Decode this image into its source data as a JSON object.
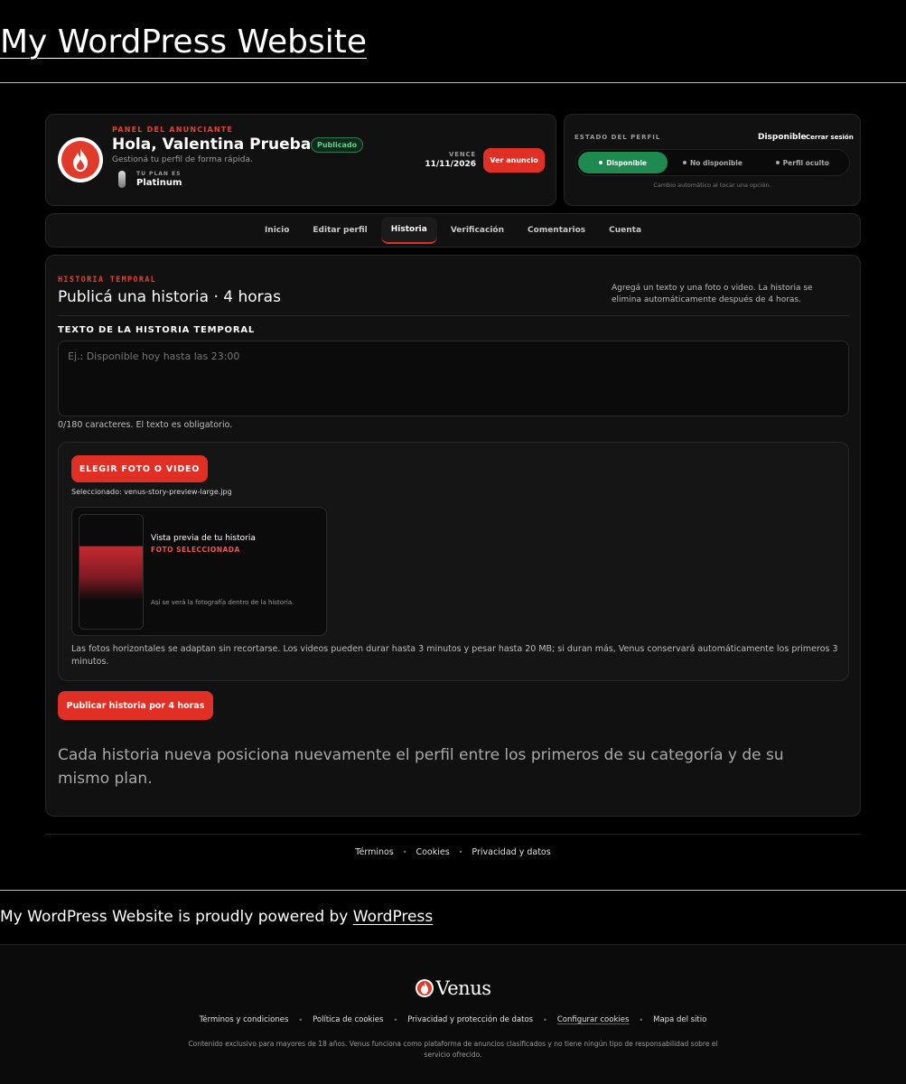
{
  "site": {
    "title": "My WordPress Website"
  },
  "profile_header": {
    "panel_label": "PANEL DEL ANUNCIANTE",
    "greeting": "Hola, Valentina Prueba",
    "status_badge": "Publicado",
    "subtitle": "Gestioná tu perfil de forma rápida.",
    "plan_label": "TU PLAN ES",
    "plan_value": "Platinum",
    "expires_label": "VENCE",
    "expires_value": "11/11/2026",
    "view_ad_button": "Ver anuncio"
  },
  "profile_state": {
    "label": "ESTADO DEL PERFIL",
    "current": "Disponible",
    "logout": "Cerrar sesión",
    "options": [
      "Disponible",
      "No disponible",
      "Perfil oculto"
    ],
    "active_option": "Disponible",
    "note": "Cambio automático al tocar una opción."
  },
  "tabs": [
    "Inicio",
    "Editar perfil",
    "Historia",
    "Verificación",
    "Comentarios",
    "Cuenta"
  ],
  "active_tab": "Historia",
  "story": {
    "kicker": "HISTORIA TEMPORAL",
    "title": "Publicá una historia · 4 horas",
    "side_note": "Agregá un texto y una foto o video. La historia se elimina automáticamente después de 4 horas.",
    "field_label": "TEXTO DE LA HISTORIA TEMPORAL",
    "placeholder": "Ej.: Disponible hoy hasta las 23:00",
    "char_count": "0/180 caracteres. El texto es obligatorio.",
    "pick_button": "ELEGIR FOTO O VIDEO",
    "selected_file": "Seleccionado: venus-story-preview-large.jpg",
    "preview_title": "Vista previa de tu historia",
    "preview_tag": "FOTO SELECCIONADA",
    "preview_note": "Así se verá la fotografía dentro de la historia.",
    "media_note": "Las fotos horizontales se adaptan sin recortarse. Los videos pueden durar hasta 3 minutos y pesar hasta 20 MB; si duran más, Venus conservará automáticamente los primeros 3 minutos.",
    "publish_button": "Publicar historia por 4 horas",
    "cta": "Cada historia nueva posiciona nuevamente el perfil entre los primeros de su categoría y de su mismo plan."
  },
  "inner_links": [
    "Términos",
    "Cookies",
    "Privacidad y datos"
  ],
  "powered": {
    "text": "My WordPress Website is proudly powered by ",
    "link": "WordPress"
  },
  "footer": {
    "brand": "Venus",
    "links": [
      "Términos y condiciones",
      "Política de cookies",
      "Privacidad y protección de datos",
      "Configurar cookies",
      "Mapa del sitio"
    ],
    "disclaimer": "Contenido exclusivo para mayores de 18 años. Venus funciona como plataforma de anuncios clasificados y no tiene ningún tipo de responsabilidad sobre el servicio ofrecido."
  },
  "colors": {
    "accent": "#e03026",
    "success": "#1f8a4f",
    "background": "#000000",
    "card": "#111111"
  }
}
